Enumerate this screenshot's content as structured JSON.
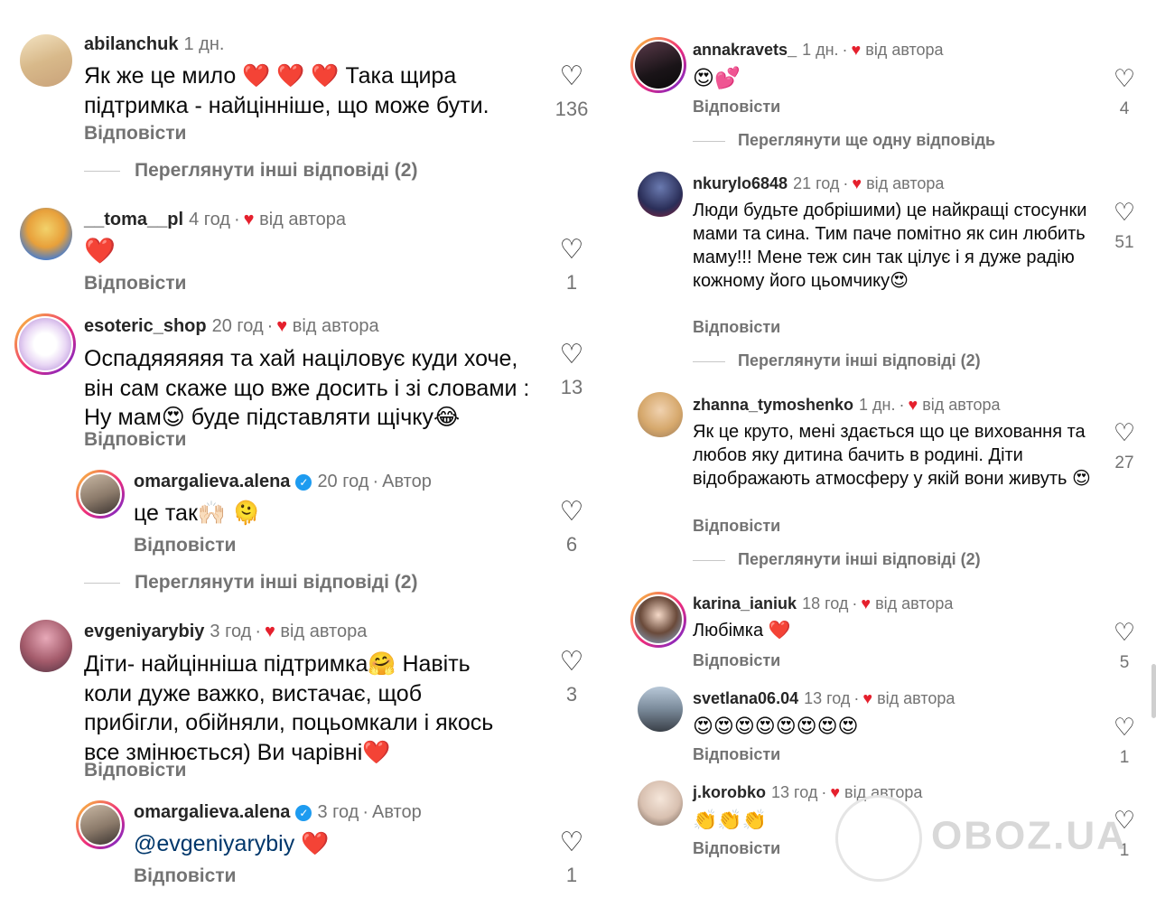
{
  "colors": {
    "accent_red": "#e5202d",
    "verified_blue": "#1d9bf0",
    "secondary_text": "#737373"
  },
  "left": {
    "c1": {
      "user": "abilanchuk",
      "time": "1 дн.",
      "text": "Як же це мило ❤️ ❤️ ❤️ Така щира підтримка - найцінніше, що може бути.",
      "reply": "Відповісти",
      "likes": "136",
      "more": "Переглянути інші відповіді (2)"
    },
    "c2": {
      "user": "__toma__pl",
      "time": "4 год",
      "badge": "від автора",
      "text": "❤️",
      "reply": "Відповісти",
      "likes": "1"
    },
    "c3": {
      "user": "esoteric_shop",
      "time": "20 год",
      "badge": "від автора",
      "text": "Оспадяяяяяя та хай націловує куди хоче, він сам скаже що вже досить і зі словами : Ну мам😍 буде підставляти щічку😂",
      "reply": "Відповісти",
      "likes": "13"
    },
    "r1": {
      "user": "omargalieva.alena",
      "time": "20 год",
      "author": "Автор",
      "text": "це так🙌🏻 🫠",
      "reply": "Відповісти",
      "likes": "6",
      "more": "Переглянути інші відповіді (2)"
    },
    "c4": {
      "user": "evgeniyarybiy",
      "time": "3 год",
      "badge": "від автора",
      "text": "Діти- найцінніша підтримка🤗 Навіть коли дуже важко, вистачає, щоб прибігли, обійняли, поцьомкали і якось все змінюється) Ви чарівні❤️",
      "reply": "Відповісти",
      "likes": "3"
    },
    "r2": {
      "user": "omargalieva.alena",
      "time": "3 год",
      "author": "Автор",
      "mention": "@evgeniyarybiy",
      "text": " ❤️",
      "reply": "Відповісти",
      "likes": "1"
    }
  },
  "right": {
    "c1": {
      "user": "annakravets_",
      "time": "1 дн.",
      "badge": "від автора",
      "text": "😍💕",
      "reply": "Відповісти",
      "likes": "4",
      "more": "Переглянути ще одну відповідь"
    },
    "c2": {
      "user": "nkurylo6848",
      "time": "21 год",
      "badge": "від автора",
      "text": "Люди будьте добрішими) це найкращі стосунки мами та сина. Тим паче помітно як син любить маму!!! Мене теж син так цілує і я дуже радію кожному його цьомчику😍",
      "reply": "Відповісти",
      "likes": "51",
      "more": "Переглянути інші відповіді (2)"
    },
    "c3": {
      "user": "zhanna_tymoshenko",
      "time": "1 дн.",
      "badge": "від автора",
      "text": "Як це круто, мені здається що це виховання та любов яку дитина бачить в родині. Діти відображають атмосферу у якій вони живуть 😍",
      "reply": "Відповісти",
      "likes": "27",
      "more": "Переглянути інші відповіді (2)"
    },
    "c4": {
      "user": "karina_ianiuk",
      "time": "18 год",
      "badge": "від автора",
      "text": "Любімка ❤️",
      "reply": "Відповісти",
      "likes": "5"
    },
    "c5": {
      "user": "svetlana06.04",
      "time": "13 год",
      "badge": "від автора",
      "text": "😍😍😍😍😍😍😍😍",
      "reply": "Відповісти",
      "likes": "1"
    },
    "c6": {
      "user": "j.korobko",
      "time": "13 год",
      "badge": "від автора",
      "text": "👏👏👏",
      "reply": "Відповісти",
      "likes": "1"
    }
  },
  "watermark": "OBOZ.UA"
}
